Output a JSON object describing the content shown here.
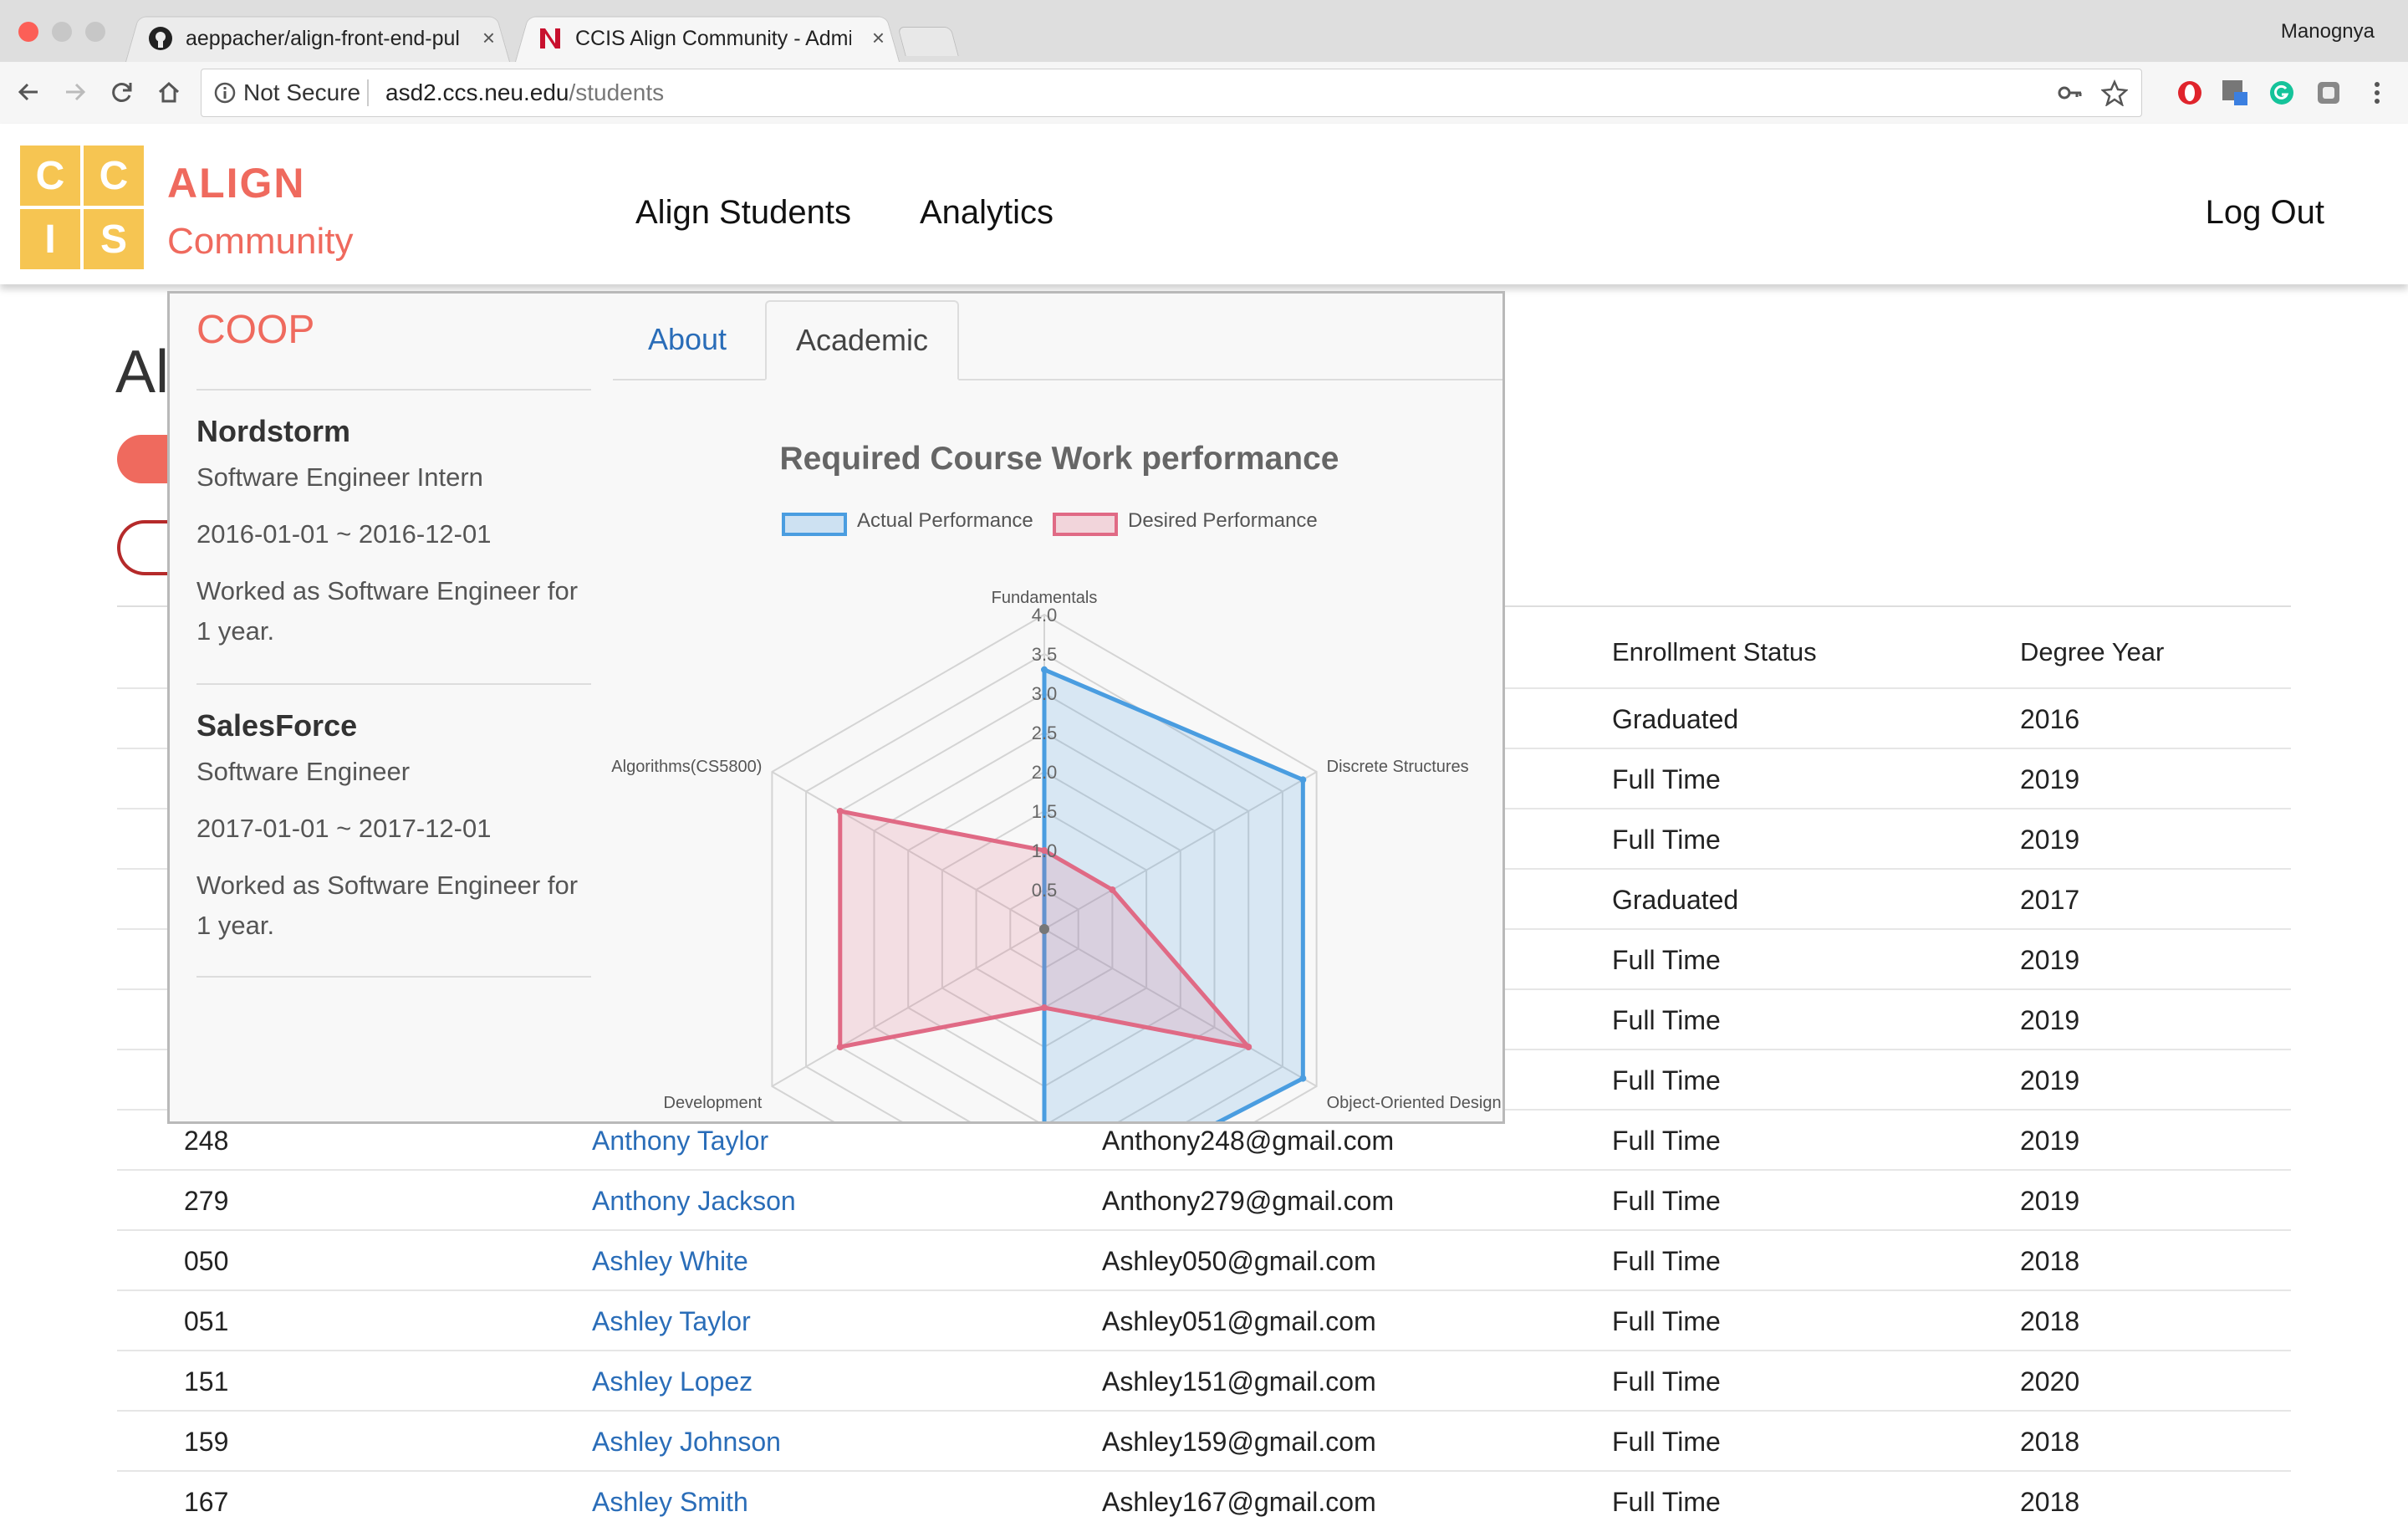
{
  "browser": {
    "tabs": [
      {
        "title": "aeppacher/align-front-end-pul",
        "favicon": "github-icon"
      },
      {
        "title": "CCIS Align Community - Admin",
        "favicon": "neu-icon"
      }
    ],
    "profile": "Manognya",
    "security": "Not Secure",
    "url_host": "asd2.ccs.neu.edu",
    "url_path": "/students"
  },
  "site": {
    "logo_letters": [
      "C",
      "C",
      "I",
      "S"
    ],
    "brand_title": "ALIGN",
    "brand_subtitle": "Community",
    "nav": [
      "Align Students",
      "Analytics"
    ],
    "logout": "Log Out",
    "page_title_partial": "Al"
  },
  "table": {
    "headers": {
      "enrollment": "Enrollment Status",
      "degree_year": "Degree Year"
    },
    "partial_rows": [
      {
        "status": "Graduated",
        "year": "2016"
      },
      {
        "status": "Full Time",
        "year": "2019"
      },
      {
        "status": "Full Time",
        "year": "2019"
      },
      {
        "status": "Graduated",
        "year": "2017"
      },
      {
        "status": "Full Time",
        "year": "2019"
      },
      {
        "status": "Full Time",
        "year": "2019"
      },
      {
        "status": "Full Time",
        "year": "2019"
      }
    ],
    "rows": [
      {
        "id": "248",
        "name": "Anthony Taylor",
        "email": "Anthony248@gmail.com",
        "status": "Full Time",
        "year": "2019"
      },
      {
        "id": "279",
        "name": "Anthony Jackson",
        "email": "Anthony279@gmail.com",
        "status": "Full Time",
        "year": "2019"
      },
      {
        "id": "050",
        "name": "Ashley White",
        "email": "Ashley050@gmail.com",
        "status": "Full Time",
        "year": "2018"
      },
      {
        "id": "051",
        "name": "Ashley Taylor",
        "email": "Ashley051@gmail.com",
        "status": "Full Time",
        "year": "2018"
      },
      {
        "id": "151",
        "name": "Ashley Lopez",
        "email": "Ashley151@gmail.com",
        "status": "Full Time",
        "year": "2020"
      },
      {
        "id": "159",
        "name": "Ashley Johnson",
        "email": "Ashley159@gmail.com",
        "status": "Full Time",
        "year": "2018"
      },
      {
        "id": "167",
        "name": "Ashley Smith",
        "email": "Ashley167@gmail.com",
        "status": "Full Time",
        "year": "2018"
      }
    ]
  },
  "popup": {
    "coop_title": "COOP",
    "coops": [
      {
        "company": "Nordstorm",
        "role": "Software Engineer Intern",
        "dates": "2016-01-01 ~ 2016-12-01",
        "desc": "Worked as Software Engineer for 1 year."
      },
      {
        "company": "SalesForce",
        "role": "Software Engineer",
        "dates": "2017-01-01 ~ 2017-12-01",
        "desc": "Worked as Software Engineer for 1 year."
      }
    ],
    "tabs": [
      "About",
      "Academic"
    ],
    "active_tab": "Academic"
  },
  "chart_data": {
    "type": "radar",
    "title": "Required Course Work performance",
    "axes": [
      "Fundamentals",
      "Discrete Structures",
      "Object-Oriented Design",
      "",
      "Development",
      "Algorithms(CS5800)"
    ],
    "scale": {
      "min": 0,
      "max": 4.0,
      "step": 0.5
    },
    "tick_labels": [
      "0.5",
      "1.0",
      "1.5",
      "2.0",
      "2.5",
      "3.0",
      "3.5",
      "4.0"
    ],
    "series": [
      {
        "name": "Actual Performance",
        "color": "#4a9de0",
        "fill": "rgba(74,157,224,0.18)",
        "values": [
          3.3,
          3.8,
          3.8,
          3.6,
          0,
          0
        ]
      },
      {
        "name": "Desired Performance",
        "color": "#e06a85",
        "fill": "rgba(224,106,133,0.18)",
        "values": [
          1.0,
          1.0,
          3.0,
          1.0,
          3.0,
          3.0
        ]
      }
    ]
  }
}
